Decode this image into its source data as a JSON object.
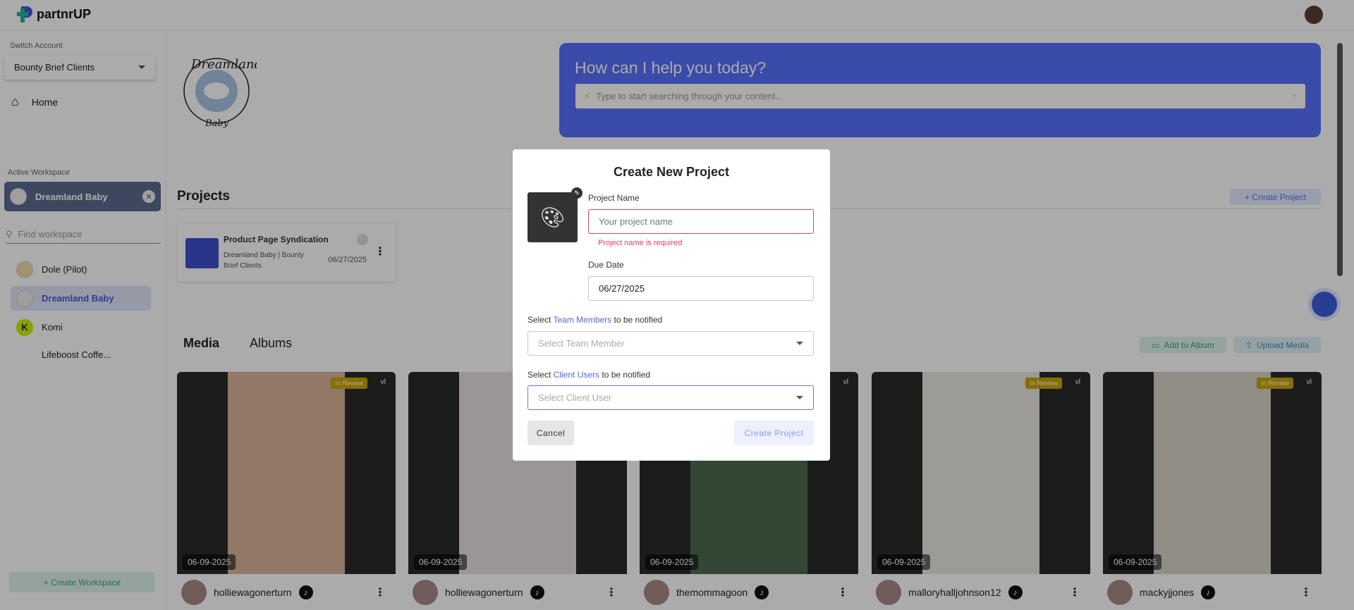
{
  "app": {
    "name": "partnrUP"
  },
  "sidebar": {
    "switch_account_label": "Switch Account",
    "account": "Bounty Brief Clients",
    "home": "Home",
    "active_workspace_label": "Active Workspace",
    "active_workspace": "Dreamland Baby",
    "find_placeholder": "Find workspace",
    "workspaces": [
      {
        "label": "Dole (Pilot)"
      },
      {
        "label": "Dreamland Baby"
      },
      {
        "label": "Komi"
      },
      {
        "label": "Lifeboost Coffe..."
      }
    ],
    "create_workspace": "+ Create Workspace"
  },
  "brand": {
    "logo_text": "Dreamland Baby"
  },
  "banner": {
    "title": "How can I help you today?",
    "search_placeholder": "Type to start searching through your content..."
  },
  "projects": {
    "heading": "Projects",
    "create_label": "+ Create Project",
    "items": [
      {
        "title": "Product Page Syndication",
        "subtitle": "Dreamland Baby | Bounty Brief Clients",
        "date": "06/27/2025",
        "color": "#3d4fd0"
      }
    ]
  },
  "media": {
    "tabs": [
      {
        "label": "Media"
      },
      {
        "label": "Albums"
      }
    ],
    "add_to_album": "Add to Album",
    "upload": "Upload Media",
    "cards": [
      {
        "status": "In Review",
        "version": "vl",
        "date": "06-09-2025",
        "user": "holliewagonerturn"
      },
      {
        "status": "",
        "version": "",
        "date": "06-09-2025",
        "user": "holliewagonerturn"
      },
      {
        "status": "",
        "version": "vl",
        "date": "06-09-2025",
        "user": "themommagoon"
      },
      {
        "status": "In Review",
        "version": "vl",
        "date": "06-09-2025",
        "user": "malloryhalljohnson12"
      },
      {
        "status": "In Review",
        "version": "vl",
        "date": "06-09-2025",
        "user": "mackyjjones"
      }
    ]
  },
  "modal": {
    "title": "Create New Project",
    "project_name_label": "Project Name",
    "project_name_placeholder": "Your project name",
    "project_name_value": "",
    "error": "Project name is required",
    "due_date_label": "Due Date",
    "due_date": "06/27/2025",
    "team_label_pre": "Select ",
    "team_label_accent": "Team Members",
    "team_label_post": " to be notified",
    "team_placeholder": "Select Team Member",
    "client_label_pre": "Select ",
    "client_label_accent": "Client Users",
    "client_label_post": " to be notified",
    "client_placeholder": "Select Client User",
    "cancel": "Cancel",
    "create": "Create Project"
  },
  "colors": {
    "primary": "#5870fc",
    "error": "#e0435e",
    "badge": "#c9a400"
  }
}
